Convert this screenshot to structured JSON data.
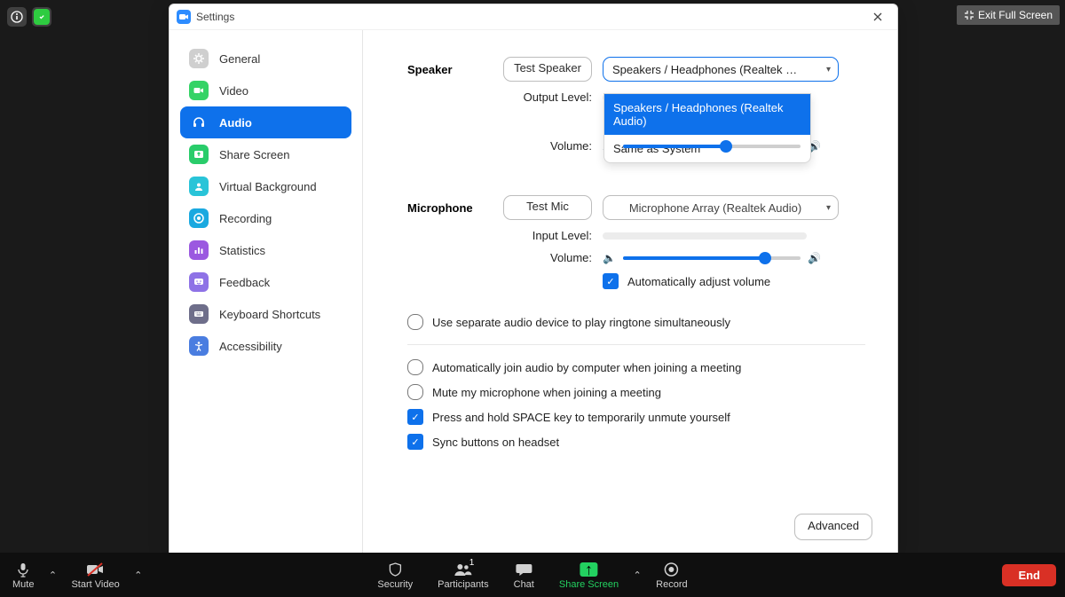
{
  "exit_fullscreen": "Exit Full Screen",
  "settings": {
    "title": "Settings",
    "sidebar": [
      {
        "label": "General"
      },
      {
        "label": "Video"
      },
      {
        "label": "Audio"
      },
      {
        "label": "Share Screen"
      },
      {
        "label": "Virtual Background"
      },
      {
        "label": "Recording"
      },
      {
        "label": "Statistics"
      },
      {
        "label": "Feedback"
      },
      {
        "label": "Keyboard Shortcuts"
      },
      {
        "label": "Accessibility"
      }
    ],
    "speaker": {
      "title": "Speaker",
      "test_btn": "Test Speaker",
      "selected": "Speakers / Headphones (Realtek …",
      "dropdown": [
        "Speakers / Headphones (Realtek Audio)",
        "Same as System"
      ],
      "output_level_label": "Output Level:",
      "volume_label": "Volume:",
      "volume_pct": 58
    },
    "microphone": {
      "title": "Microphone",
      "test_btn": "Test Mic",
      "selected": "Microphone Array (Realtek Audio)",
      "input_level_label": "Input Level:",
      "volume_label": "Volume:",
      "volume_pct": 80,
      "auto_adjust": "Automatically adjust volume"
    },
    "options": {
      "ringtone": "Use separate audio device to play ringtone simultaneously",
      "autojoin": "Automatically join audio by computer when joining a meeting",
      "automute": "Mute my microphone when joining a meeting",
      "space": "Press and hold SPACE key to temporarily unmute yourself",
      "sync": "Sync buttons on headset"
    },
    "advanced_btn": "Advanced"
  },
  "toolbar": {
    "mute": "Mute",
    "video": "Start Video",
    "security": "Security",
    "participants": "Participants",
    "participants_count": "1",
    "chat": "Chat",
    "share": "Share Screen",
    "record": "Record",
    "end": "End"
  }
}
